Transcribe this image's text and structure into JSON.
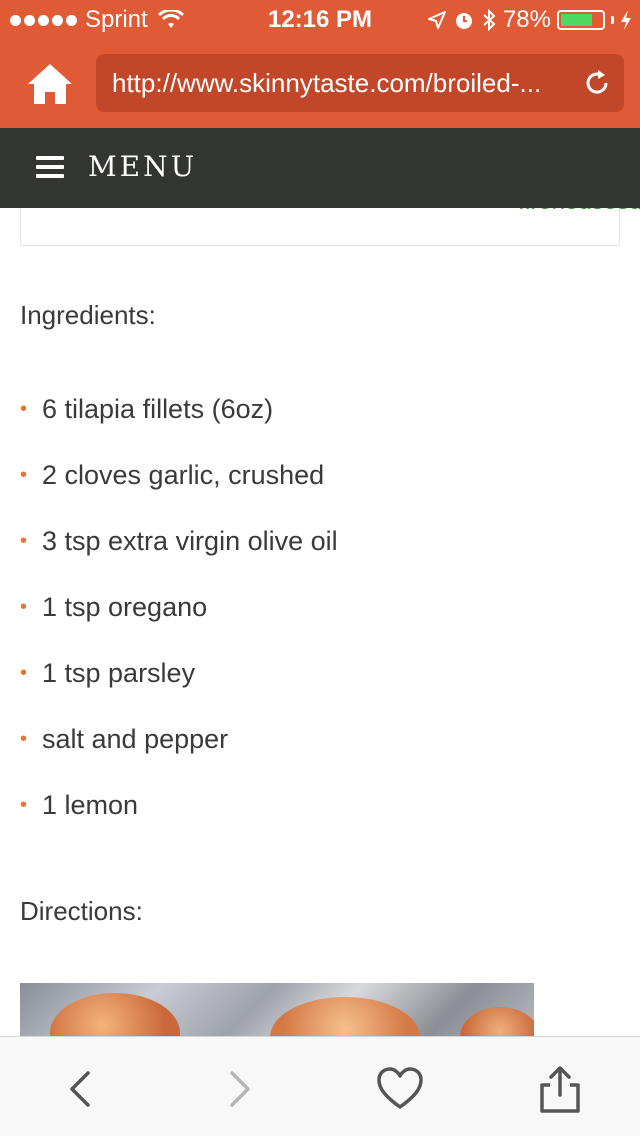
{
  "status_bar": {
    "carrier": "Sprint",
    "time": "12:16 PM",
    "battery_percent": "78%",
    "battery_level": 0.78,
    "icons": [
      "signal-dots-icon",
      "wifi-icon",
      "location-icon",
      "alarm-icon",
      "bluetooth-icon",
      "battery-icon",
      "charging-icon"
    ]
  },
  "browser": {
    "url": "http://www.skinnytaste.com/broiled-...",
    "home_icon": "home-icon",
    "reload_icon": "reload-icon"
  },
  "menu": {
    "label": "MENU"
  },
  "ad": {
    "link_text": "firehousesubs.com"
  },
  "recipe": {
    "ingredients_heading": "Ingredients:",
    "ingredients": [
      "6 tilapia fillets (6oz)",
      "2 cloves garlic, crushed",
      "3 tsp extra virgin olive oil",
      "1 tsp oregano",
      "1 tsp parsley",
      "salt and pepper",
      "1 lemon"
    ],
    "directions_heading": "Directions:"
  },
  "toolbar": {
    "buttons": [
      "back-icon",
      "forward-icon",
      "favorite-heart-icon",
      "share-icon"
    ]
  },
  "colors": {
    "accent": "#e05a36",
    "menu_bar": "#333533",
    "bullet": "#e5762a",
    "ad_link": "#2a9d2a"
  }
}
